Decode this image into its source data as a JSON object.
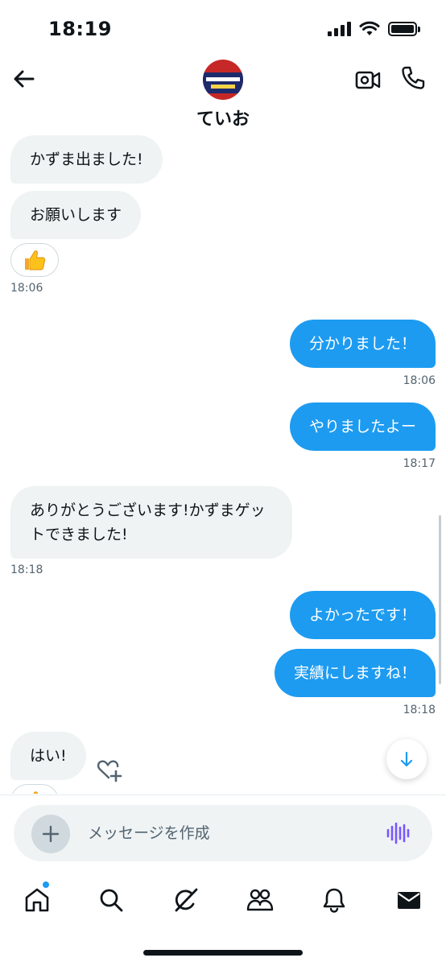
{
  "status_bar": {
    "time": "18:19"
  },
  "header": {
    "name": "ていお"
  },
  "messages": [
    {
      "dir": "in",
      "text": "かずま出ました!"
    },
    {
      "dir": "in",
      "text": "お願いします",
      "reaction": "thumbs-up",
      "time": "18:06"
    },
    {
      "dir": "out",
      "text": "分かりました！",
      "time": "18:06"
    },
    {
      "dir": "out",
      "text": "やりましたよー",
      "time": "18:17"
    },
    {
      "dir": "in",
      "text": "ありがとうございます!かずまゲットできました!",
      "time": "18:18"
    },
    {
      "dir": "out",
      "text": "よかったです！"
    },
    {
      "dir": "out",
      "text": "実績にしますね！",
      "time": "18:18"
    },
    {
      "dir": "in",
      "text": "はい!",
      "reaction": "thumbs-up"
    }
  ],
  "composer": {
    "placeholder": "メッセージを作成"
  },
  "tabs": [
    "home",
    "search",
    "grok",
    "communities",
    "notifications",
    "messages"
  ],
  "colors": {
    "accent": "#1d9bf0",
    "incoming_bubble": "#eff3f4",
    "text": "#0f1419",
    "muted": "#536471"
  }
}
